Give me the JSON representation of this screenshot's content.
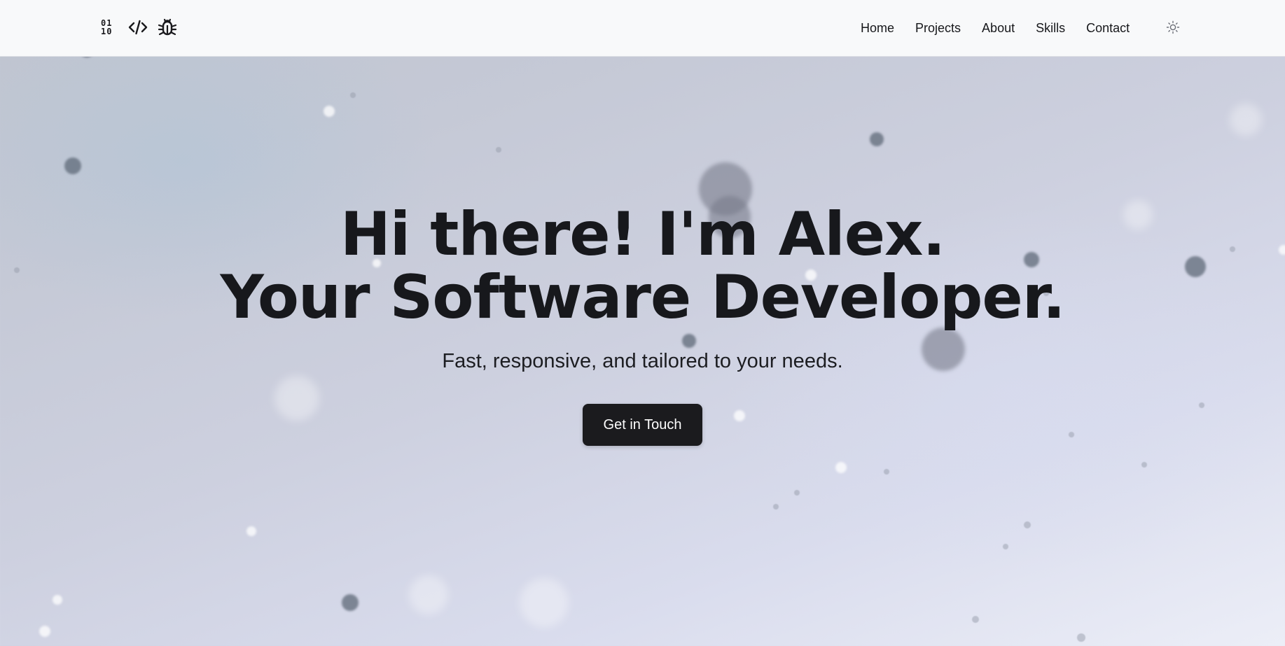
{
  "header": {
    "logo_icons": [
      "binary-icon",
      "code-icon",
      "bug-icon"
    ],
    "binary_text": [
      "01",
      "10"
    ],
    "nav": [
      {
        "label": "Home"
      },
      {
        "label": "Projects"
      },
      {
        "label": "About"
      },
      {
        "label": "Skills"
      },
      {
        "label": "Contact"
      }
    ],
    "theme_toggle_icon": "sun-icon"
  },
  "hero": {
    "headline_line1": "Hi there! I'm Alex.",
    "headline_line2": "Your Software Developer.",
    "subtitle": "Fast, responsive, and tailored to your needs.",
    "cta_label": "Get in Touch"
  },
  "colors": {
    "header_bg": "#f8f9fa",
    "text": "#17181c",
    "cta_bg": "#1b1b1e",
    "cta_text": "#ffffff"
  }
}
